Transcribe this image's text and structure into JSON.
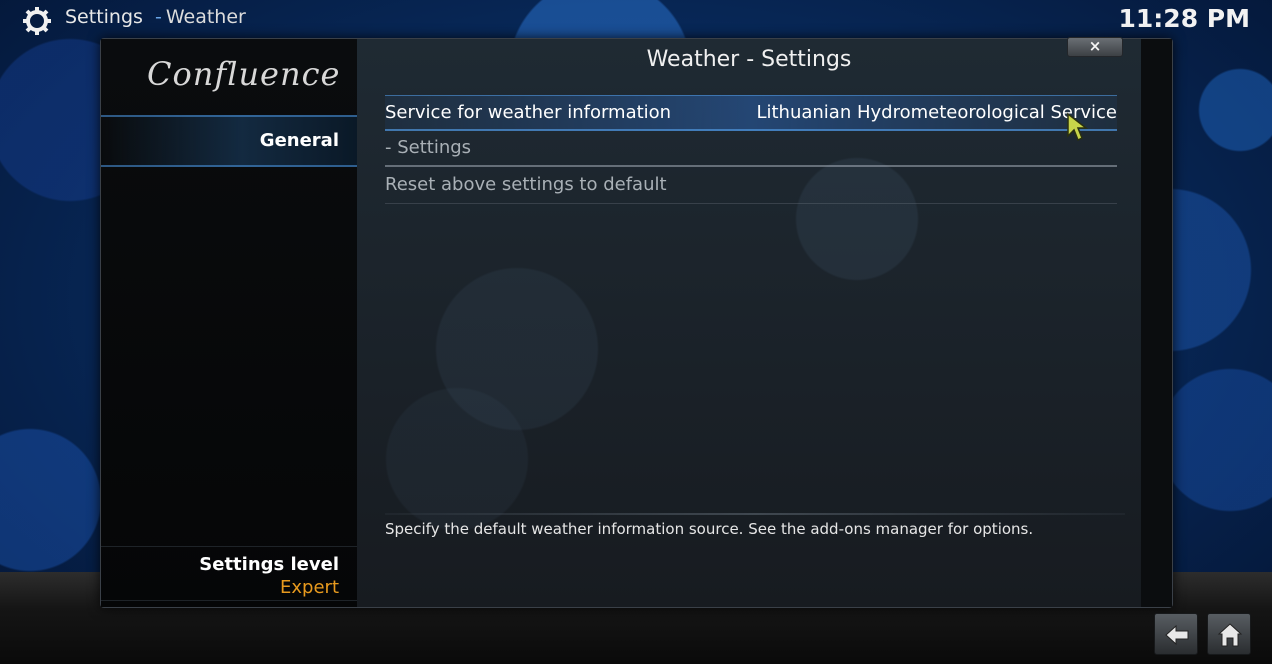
{
  "header": {
    "section": "Settings",
    "subsection": "Weather",
    "separator": "-",
    "time": "11:28 PM"
  },
  "sidebar": {
    "logo": "Confluence",
    "categories": [
      {
        "label": "General"
      }
    ],
    "settings_level": {
      "title": "Settings level",
      "value": "Expert"
    }
  },
  "dialog": {
    "title": "Weather - Settings",
    "close": "×",
    "rows": [
      {
        "label": "Service for weather information",
        "value": "Lithuanian Hydrometeorological Service"
      },
      {
        "label": "- Settings"
      },
      {
        "label": "Reset above settings to default"
      }
    ],
    "description": "Specify the default weather information source. See the add-ons manager for options."
  },
  "colors": {
    "accent": "#e89a1e",
    "focus": "#2a5a9c"
  },
  "icons": {
    "top_left": "gear-icon",
    "back": "back-arrow-icon",
    "home": "home-icon"
  }
}
